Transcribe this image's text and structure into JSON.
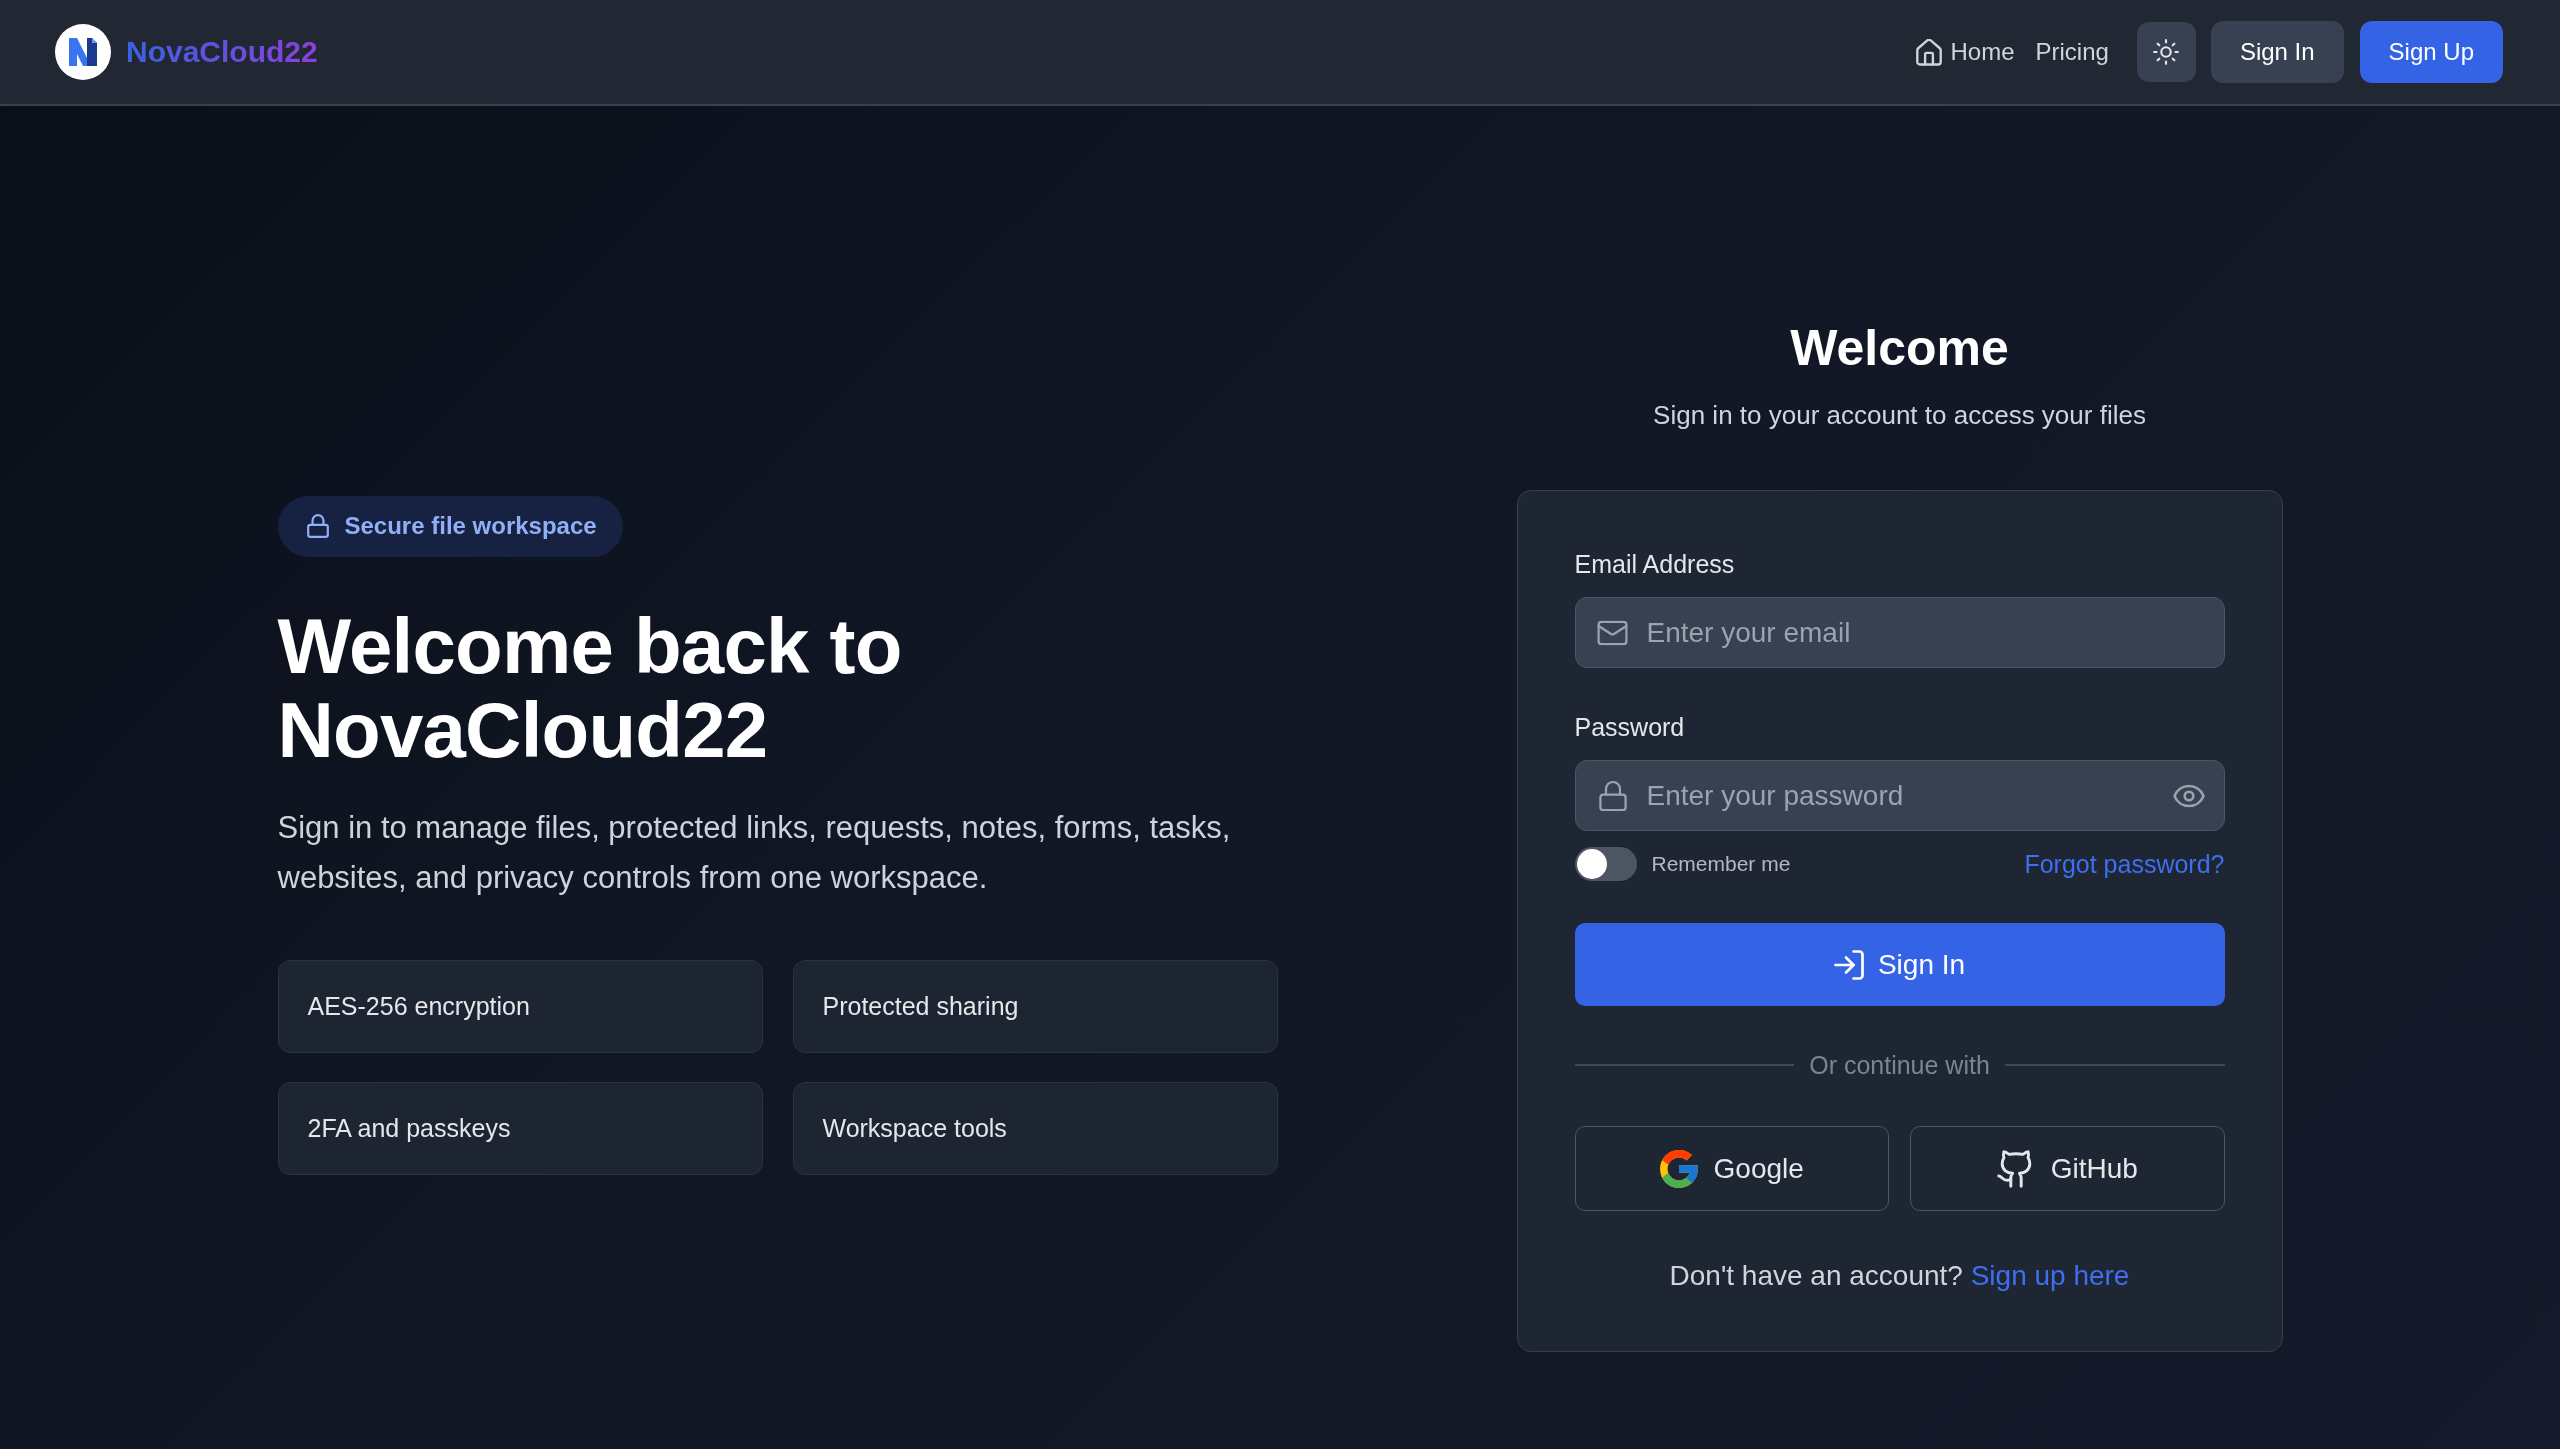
{
  "navbar": {
    "brand": "NovaCloud22",
    "links": [
      {
        "label": "Home",
        "kind": "icon_link"
      },
      {
        "label": "Pricing",
        "kind": "link"
      }
    ],
    "buttons": [
      {
        "label": "Sign In",
        "kind": "secondary"
      },
      {
        "label": "Sign Up",
        "kind": "primary"
      }
    ]
  },
  "hero": {
    "badge": "Secure file workspace",
    "heading": "Welcome back to NovaCloud22",
    "description": "Sign in to manage files, protected links, requests, notes, forms, tasks, websites, and privacy controls from one workspace.",
    "features": [
      "AES-256 encryption",
      "Protected sharing",
      "2FA and passkeys",
      "Workspace tools"
    ]
  },
  "login": {
    "title": "Welcome",
    "subtitle": "Sign in to your account to access your files",
    "fields": [
      {
        "label": "Email Address",
        "placeholder": "Enter your email",
        "kind": "email"
      },
      {
        "label": "Password",
        "placeholder": "Enter your password",
        "kind": "password"
      }
    ],
    "remember": {
      "label": "Remember me",
      "on": false
    },
    "forgot_link": "Forgot password?",
    "submit": "Sign In",
    "divider": "Or continue with",
    "social": [
      {
        "label": "Google",
        "kind": "google"
      },
      {
        "label": "GitHub",
        "kind": "github"
      }
    ],
    "signup_prompt": "Don't have an account?",
    "signup_link": "Sign up here"
  }
}
